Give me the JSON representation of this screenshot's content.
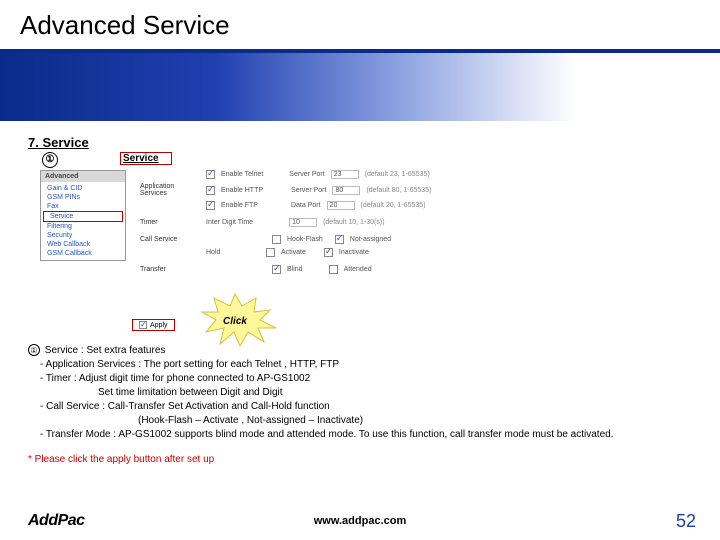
{
  "title": "Advanced Service",
  "section": "7. Service",
  "marker": "①",
  "service_label": "Service",
  "sidebar": {
    "header": "Advanced",
    "items": [
      "Gain & CID",
      "GSM PINs",
      "Fax",
      "Service",
      "Filtering",
      "Security",
      "Web Callback",
      "GSM Callback"
    ],
    "boxed_index": 3
  },
  "form": {
    "r1": {
      "lbl": "",
      "chk": "Enable Telnet",
      "field_lbl": "Server Port",
      "val": "23",
      "hint": "(default 23, 1-65535)"
    },
    "r2": {
      "lbl": "Application Services",
      "chk": "Enable HTTP",
      "field_lbl": "Server Port",
      "val": "80",
      "hint": "(default 80, 1-65535)"
    },
    "r3": {
      "lbl": "",
      "chk": "Enable FTP",
      "field_lbl": "Data Port",
      "val": "20",
      "hint": "(default 20, 1-65535)"
    },
    "r4": {
      "lbl": "Timer",
      "sub": "Inter Digit Time",
      "val": "10",
      "hint": "(default 10, 1-30(s))"
    },
    "r5": {
      "lbl": "Call Service",
      "opt1": "Hook-Flash",
      "opt2": "Not-assigned"
    },
    "r6": {
      "lbl": "",
      "sub": "Hold",
      "opt1": "Activate",
      "opt2": "Inactivate"
    },
    "r7": {
      "lbl": "Transfer",
      "opt1": "Blind",
      "opt2": "Attended"
    }
  },
  "burst": "Click",
  "apply": "Apply",
  "desc": {
    "d0": " Service : Set extra features",
    "d1": "- Application Services : The port setting for each Telnet , HTTP, FTP",
    "d2": "- Timer : Adjust digit time for phone connected to AP-GS1002",
    "d3": "Set time limitation between Digit and Digit",
    "d4": "- Call Service : Call-Transfer Set Activation and Call-Hold function",
    "d5": "(Hook-Flash – Activate , Not-assigned – Inactivate)",
    "d6": "- Transfer Mode : AP-GS1002 supports blind mode and attended mode.  To use this function, call transfer mode must be activated."
  },
  "note": "* Please click the apply button after set up",
  "logo": "AddPac",
  "url": "www.addpac.com",
  "page": "52"
}
